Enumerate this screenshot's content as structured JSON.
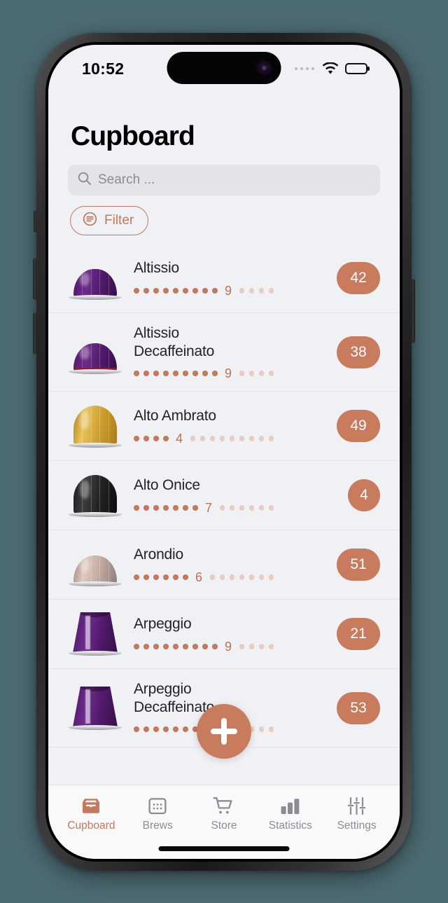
{
  "theme": {
    "accent": "#c97b5e",
    "accent_text": "#c4785c",
    "screen_bg": "#f0f1f4",
    "wallpaper": "#4d6b73"
  },
  "status_bar": {
    "time": "10:52",
    "wifi_icon": "wifi-icon",
    "battery_icon": "battery-icon",
    "signal_icon": "signal-dots-icon"
  },
  "header": {
    "title": "Cupboard"
  },
  "search": {
    "placeholder": "Search ...",
    "value": "",
    "icon": "search-icon"
  },
  "filter": {
    "label": "Filter",
    "icon": "filter-icon"
  },
  "fab": {
    "label": "+",
    "icon": "plus-icon",
    "name": "add-button"
  },
  "list": {
    "items": [
      {
        "name": "Altissio",
        "intensity": 9,
        "intensity_max": 13,
        "count": "42",
        "capsule": "vertuo-dome-purple"
      },
      {
        "name": "Altissio\nDecaffeinato",
        "intensity": 9,
        "intensity_max": 13,
        "count": "38",
        "capsule": "vertuo-dome-purple-red-band"
      },
      {
        "name": "Alto Ambrato",
        "intensity": 4,
        "intensity_max": 13,
        "count": "49",
        "capsule": "vertuo-tall-gold"
      },
      {
        "name": "Alto Onice",
        "intensity": 7,
        "intensity_max": 13,
        "count": "4",
        "capsule": "vertuo-tall-black"
      },
      {
        "name": "Arondio",
        "intensity": 6,
        "intensity_max": 13,
        "count": "51",
        "capsule": "vertuo-dome-rose"
      },
      {
        "name": "Arpeggio",
        "intensity": 9,
        "intensity_max": 13,
        "count": "21",
        "capsule": "original-cone-purple"
      },
      {
        "name": "Arpeggio\nDecaffeinato",
        "intensity": 9,
        "intensity_max": 13,
        "count": "53",
        "capsule": "original-cone-purple"
      }
    ]
  },
  "tabbar": {
    "active_index": 0,
    "tabs": [
      {
        "label": "Cupboard",
        "icon": "tray-icon"
      },
      {
        "label": "Brews",
        "icon": "calendar-grid-icon"
      },
      {
        "label": "Store",
        "icon": "cart-icon"
      },
      {
        "label": "Statistics",
        "icon": "bar-chart-icon"
      },
      {
        "label": "Settings",
        "icon": "sliders-icon"
      }
    ]
  }
}
